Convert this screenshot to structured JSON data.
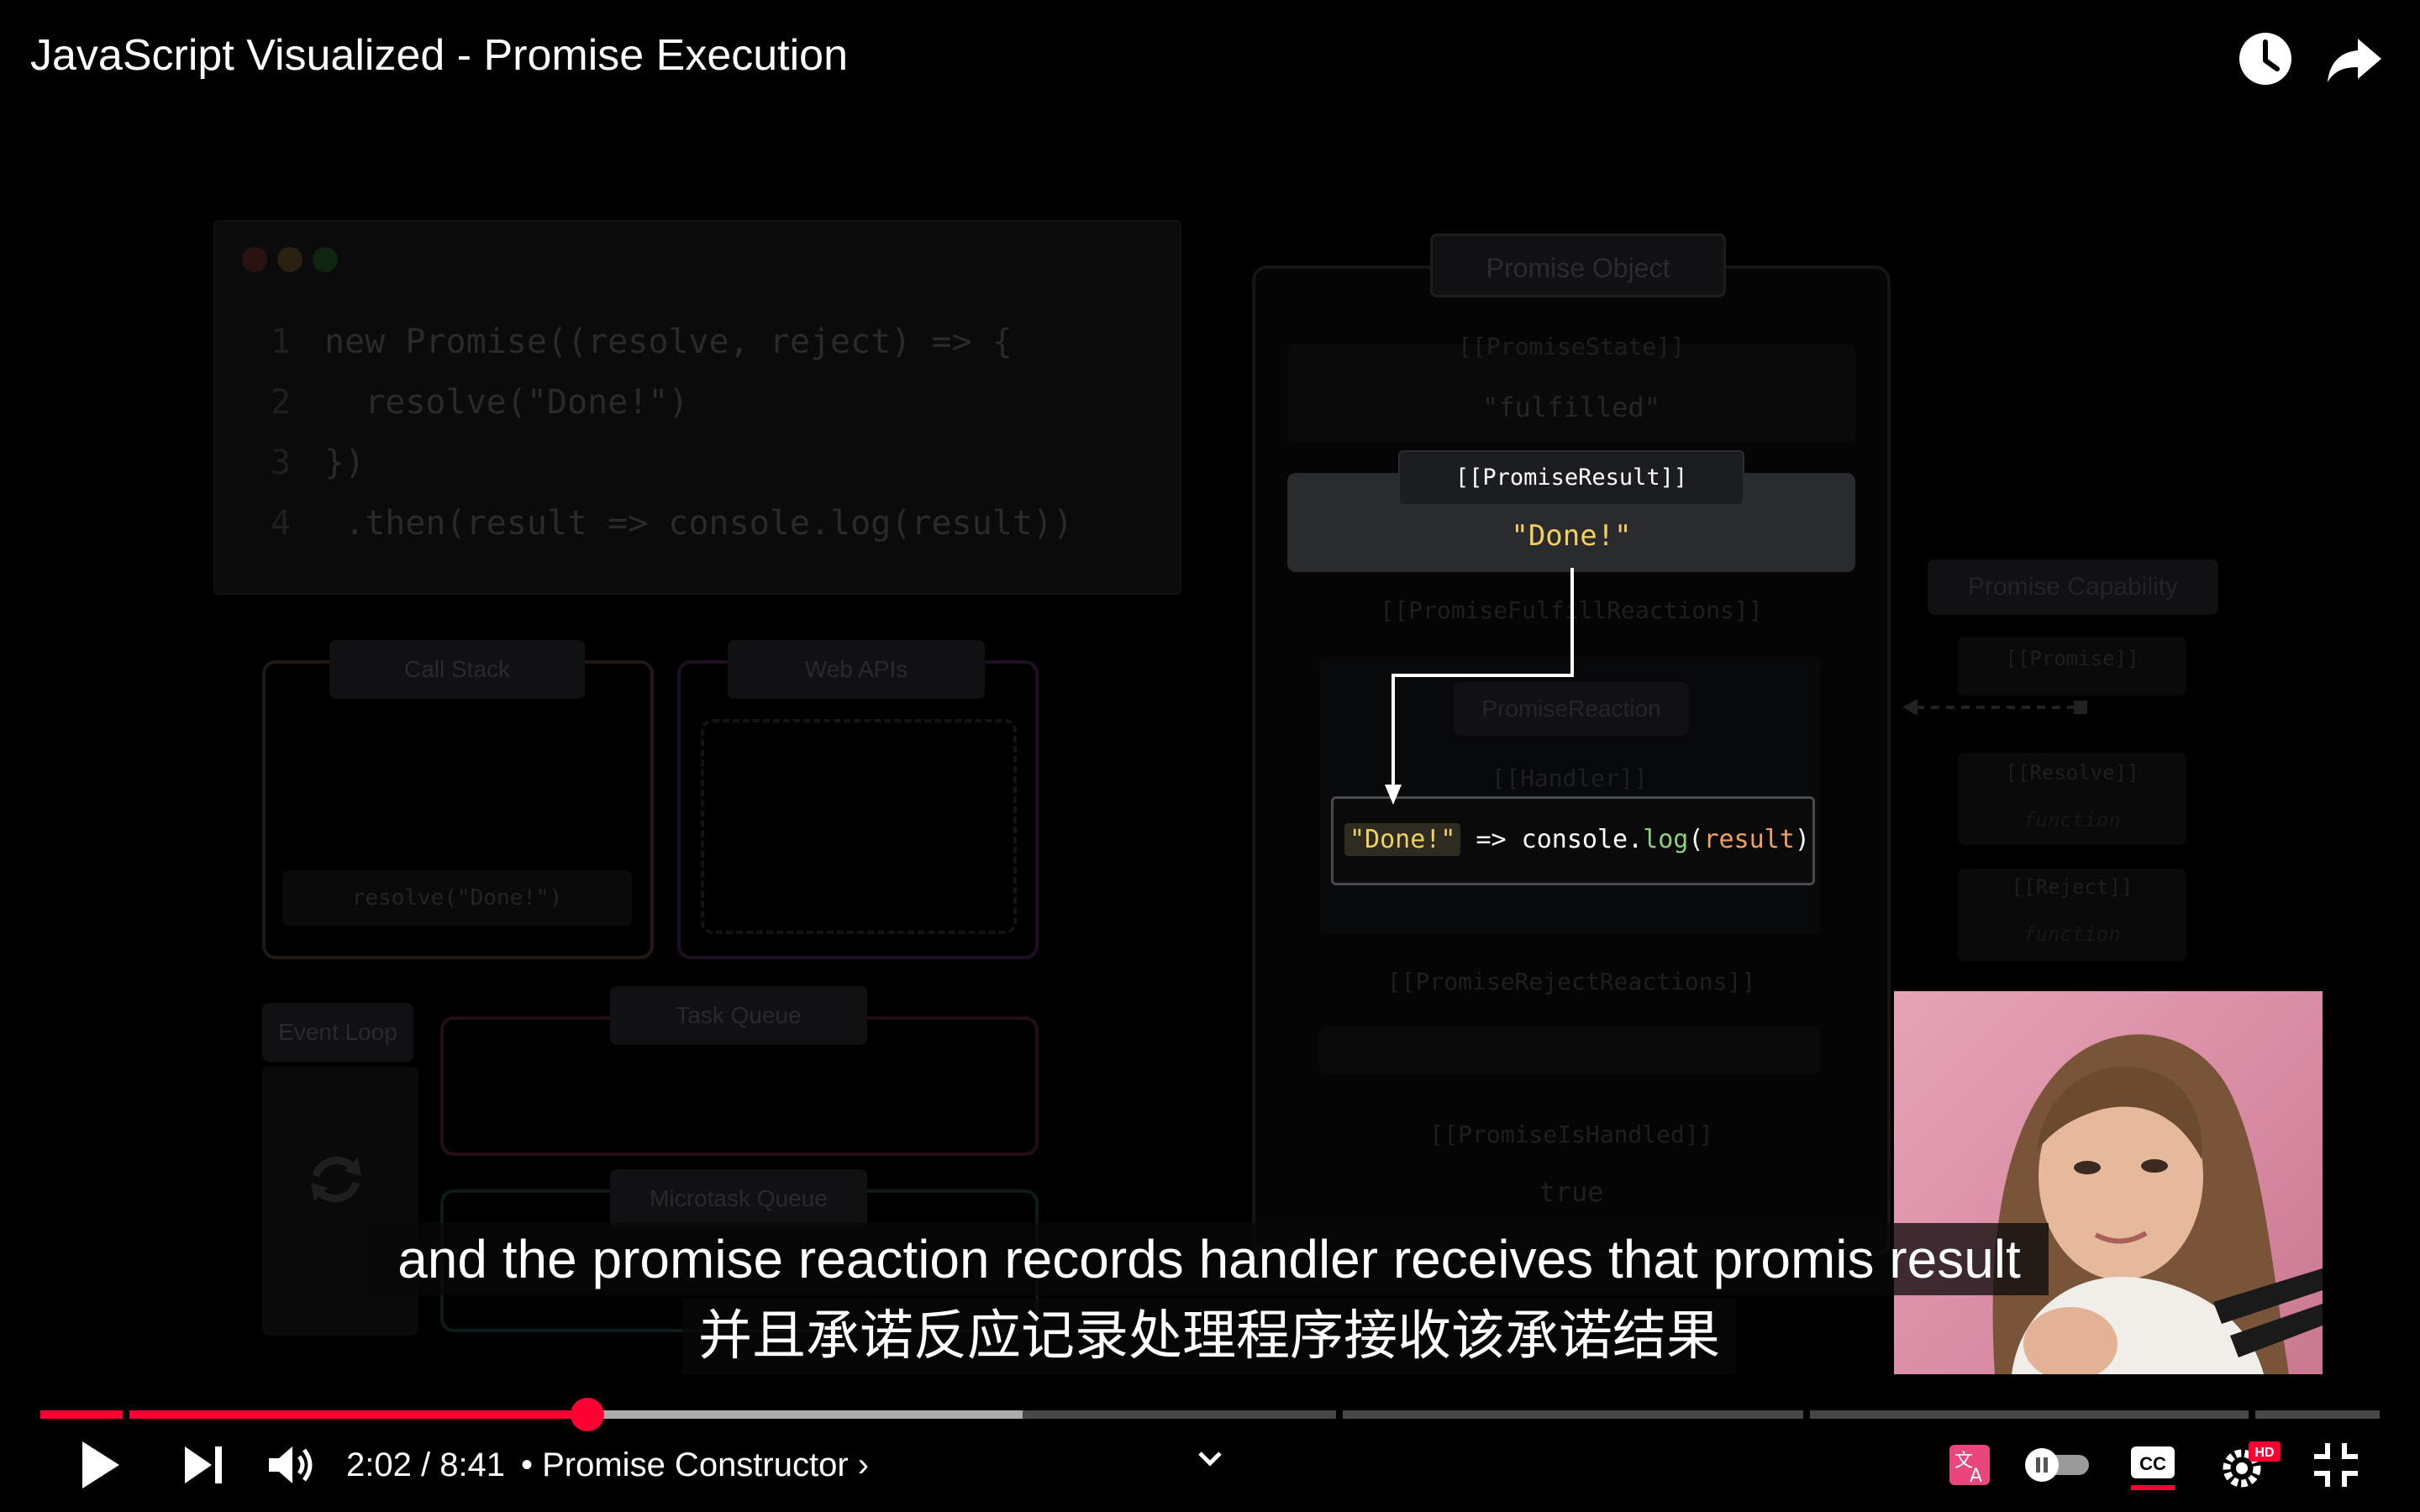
{
  "video": {
    "title": "JavaScript Visualized - Promise Execution"
  },
  "top_actions": {
    "watch_later_icon": "clock-icon",
    "share_icon": "share-arrow-icon"
  },
  "frame": {
    "code_lines": [
      {
        "num": "1",
        "text": "new Promise((resolve, reject) => {"
      },
      {
        "num": "2",
        "text": "  resolve(\"Done!\")"
      },
      {
        "num": "3",
        "text": "})"
      },
      {
        "num": "4",
        "text": " .then(result => console.log(result))"
      }
    ],
    "call_stack_label": "Call Stack",
    "call_stack_item": "resolve(\"Done!\")",
    "web_apis_label": "Web APIs",
    "event_loop_label": "Event Loop",
    "task_queue_label": "Task Queue",
    "microtask_queue_label": "Microtask Queue",
    "promise_object_label": "Promise Object",
    "promise_state_label": "[[PromiseState]]",
    "promise_state_value": "\"fulfilled\"",
    "promise_result_label": "[[PromiseResult]]",
    "promise_result_value": "\"Done!\"",
    "fulfill_reactions_label": "[[PromiseFulfillReactions]]",
    "promise_reaction_label": "PromiseReaction",
    "handler_label": "[[Handler]]",
    "handler_arg": "\"Done!\"",
    "handler_arrow": " => console.",
    "handler_fn": "log",
    "handler_open": "(",
    "handler_param": "result",
    "handler_close": ")",
    "reject_reactions_label": "[[PromiseRejectReactions]]",
    "is_handled_label": "[[PromiseIsHandled]]",
    "is_handled_value": "true",
    "capability_label": "Promise Capability",
    "cap_promise_label": "[[Promise]]",
    "cap_resolve_label": "[[Resolve]]",
    "cap_resolve_value": "function",
    "cap_reject_label": "[[Reject]]",
    "cap_reject_value": "function"
  },
  "captions": {
    "english": "and the promise reaction records handler receives that promis result",
    "chinese": "并且承诺反应记录处理程序接收该承诺结果"
  },
  "playback": {
    "current_time": "2:02",
    "duration": "8:41",
    "time_display": "2:02 / 8:41",
    "chapter": "• Promise Constructor ›",
    "played_fraction": 0.234,
    "buffered_fraction": 0.42
  },
  "controls": {
    "play_icon": "play-icon",
    "next_icon": "next-icon",
    "volume_icon": "volume-icon",
    "expand_icon": "chevron-down-icon",
    "translate_icon": "auto-translate-icon",
    "autoplay_icon": "autoplay-toggle-icon",
    "cc_label": "CC",
    "settings_icon": "gear-icon",
    "hd_badge": "HD",
    "exit_fullscreen_icon": "exit-fullscreen-icon"
  },
  "colors": {
    "accent_red": "#ff0033",
    "result_yellow": "#f3cf5e",
    "caption_bg": "#080808"
  }
}
